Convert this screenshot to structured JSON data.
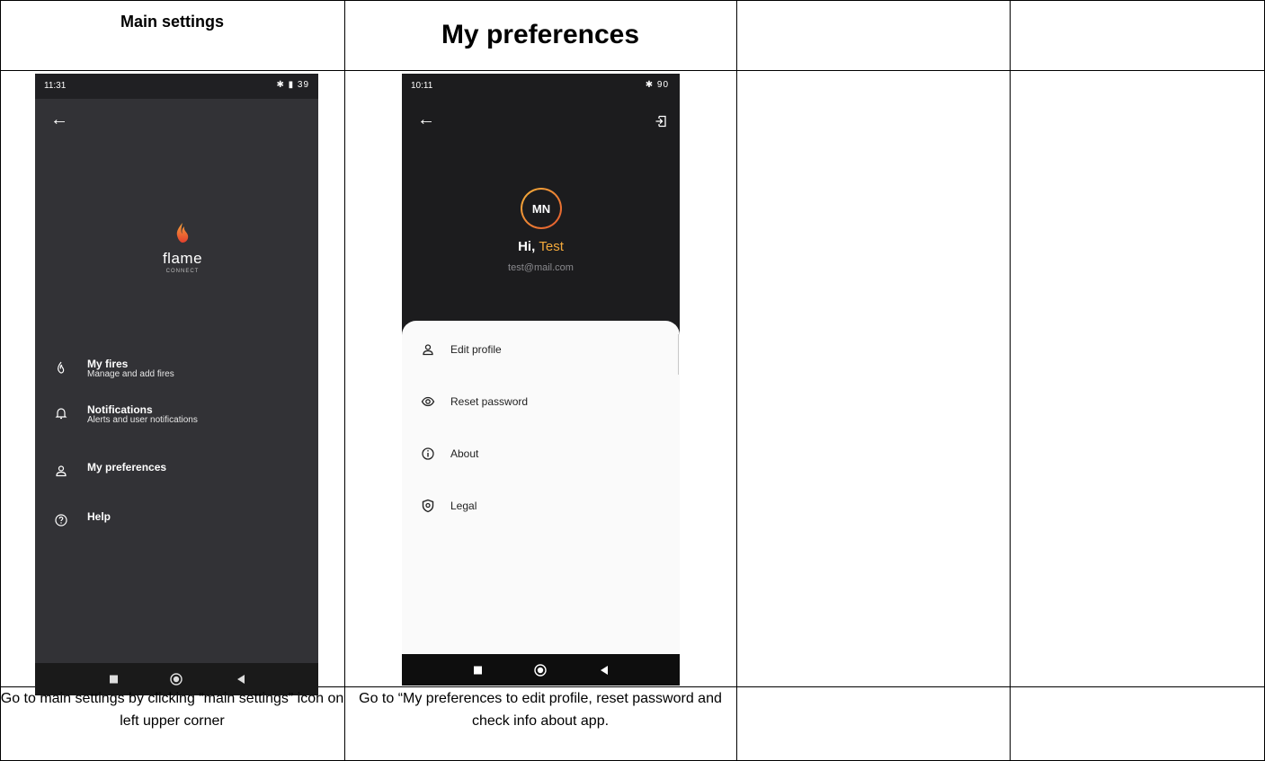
{
  "table": {
    "col1_header": "Main settings",
    "col2_header": "My preferences",
    "col1_caption": "Go to main settings by clicking “main settings” icon on left upper corner",
    "col2_caption": "Go to “My preferences to edit profile, reset password and check info about app."
  },
  "phone1": {
    "status_time": "11:31",
    "status_icons": "✱ ▮ 39",
    "logo_word": "flame",
    "logo_sub": "CONNECT",
    "menu": [
      {
        "title": "My fires",
        "subtitle": "Manage and add fires",
        "icon": "flame-icon"
      },
      {
        "title": "Notifications",
        "subtitle": "Alerts and user notifications",
        "icon": "bell-icon"
      },
      {
        "title": "My preferences",
        "subtitle": "",
        "icon": "user-icon"
      },
      {
        "title": "Help",
        "subtitle": "",
        "icon": "help-icon"
      }
    ]
  },
  "phone2": {
    "status_time": "10:11",
    "status_icons": "✱ 90",
    "avatar_initials": "MN",
    "greeting": "Hi, ",
    "user_name": "Test",
    "email": "test@mail.com",
    "menu": [
      {
        "title": "Edit profile",
        "icon": "user-icon"
      },
      {
        "title": "Reset password",
        "icon": "eye-icon"
      },
      {
        "title": "About",
        "icon": "info-icon"
      },
      {
        "title": "Legal",
        "icon": "shield-icon"
      }
    ]
  },
  "colors": {
    "accent": "#f4a93b",
    "dark_bg": "#323236",
    "profile_bg": "#1c1c1e"
  }
}
